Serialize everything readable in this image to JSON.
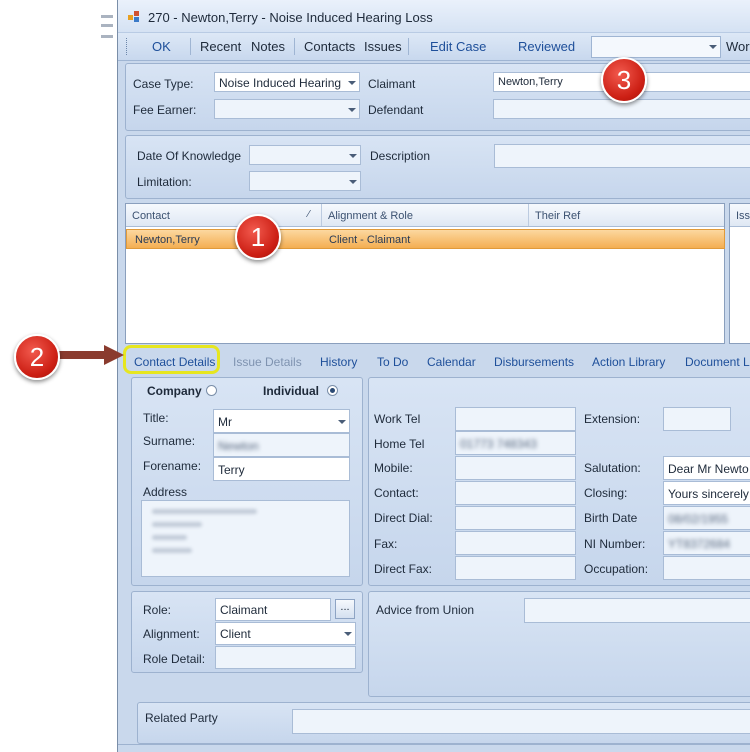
{
  "window": {
    "title": "270 - Newton,Terry - Noise Induced Hearing Loss"
  },
  "toolbar": {
    "ok": "OK",
    "recent": "Recent",
    "notes": "Notes",
    "contacts": "Contacts",
    "issues": "Issues",
    "edit_case": "Edit Case",
    "reviewed": "Reviewed",
    "combo_value": "",
    "work": "Wor"
  },
  "case": {
    "case_type_label": "Case Type:",
    "case_type_value": "Noise Induced Hearing",
    "fee_earner_label": "Fee Earner:",
    "fee_earner_value": "",
    "claimant_label": "Claimant",
    "claimant_value": "Newton,Terry",
    "defendant_label": "Defendant",
    "defendant_value": ""
  },
  "dates": {
    "dok_label": "Date Of Knowledge",
    "dok_value": "",
    "limitation_label": "Limitation:",
    "limitation_value": "",
    "description_label": "Description",
    "description_value": ""
  },
  "contacts_grid": {
    "columns": [
      "Contact",
      "Alignment & Role",
      "Their Ref"
    ],
    "rows": [
      {
        "contact": "Newton,Terry",
        "role": "Client - Claimant",
        "ref": ""
      }
    ],
    "issues_header": "Issu"
  },
  "tabs": [
    "Contact Details",
    "Issue Details",
    "History",
    "To Do",
    "Calendar",
    "Disbursements",
    "Action Library",
    "Document L"
  ],
  "contact": {
    "company_label": "Company",
    "individual_label": "Individual",
    "title_label": "Title:",
    "title_value": "Mr",
    "surname_label": "Surname:",
    "surname_value": "Newton",
    "forename_label": "Forename:",
    "forename_value": "Terry",
    "address_label": "Address"
  },
  "phones": {
    "work_tel": "Work Tel",
    "home_tel": "Home Tel",
    "home_tel_value": "01773 748343",
    "mobile": "Mobile:",
    "contact": "Contact:",
    "direct_dial": "Direct Dial:",
    "fax": "Fax:",
    "direct_fax": "Direct Fax:",
    "extension": "Extension:",
    "salutation": "Salutation:",
    "salutation_value": "Dear Mr Newto",
    "closing": "Closing:",
    "closing_value": "Yours sincerely",
    "birth_date": "Birth Date",
    "birth_date_value": "08/02/1955",
    "ni_number": "NI Number:",
    "ni_number_value": "YT8372684",
    "occupation": "Occupation:"
  },
  "role": {
    "role_label": "Role:",
    "role_value": "Claimant",
    "ellipsis": "...",
    "alignment_label": "Alignment:",
    "alignment_value": "Client",
    "role_detail_label": "Role Detail:"
  },
  "union": {
    "label": "Advice from Union"
  },
  "related": {
    "label": "Related Party"
  },
  "callouts": {
    "one": "1",
    "two": "2",
    "three": "3"
  },
  "colors": {
    "accent": "#1e4f9a",
    "selected_row": "#f4ae52",
    "callout": "#cc1f14",
    "highlight": "#e6e620"
  }
}
